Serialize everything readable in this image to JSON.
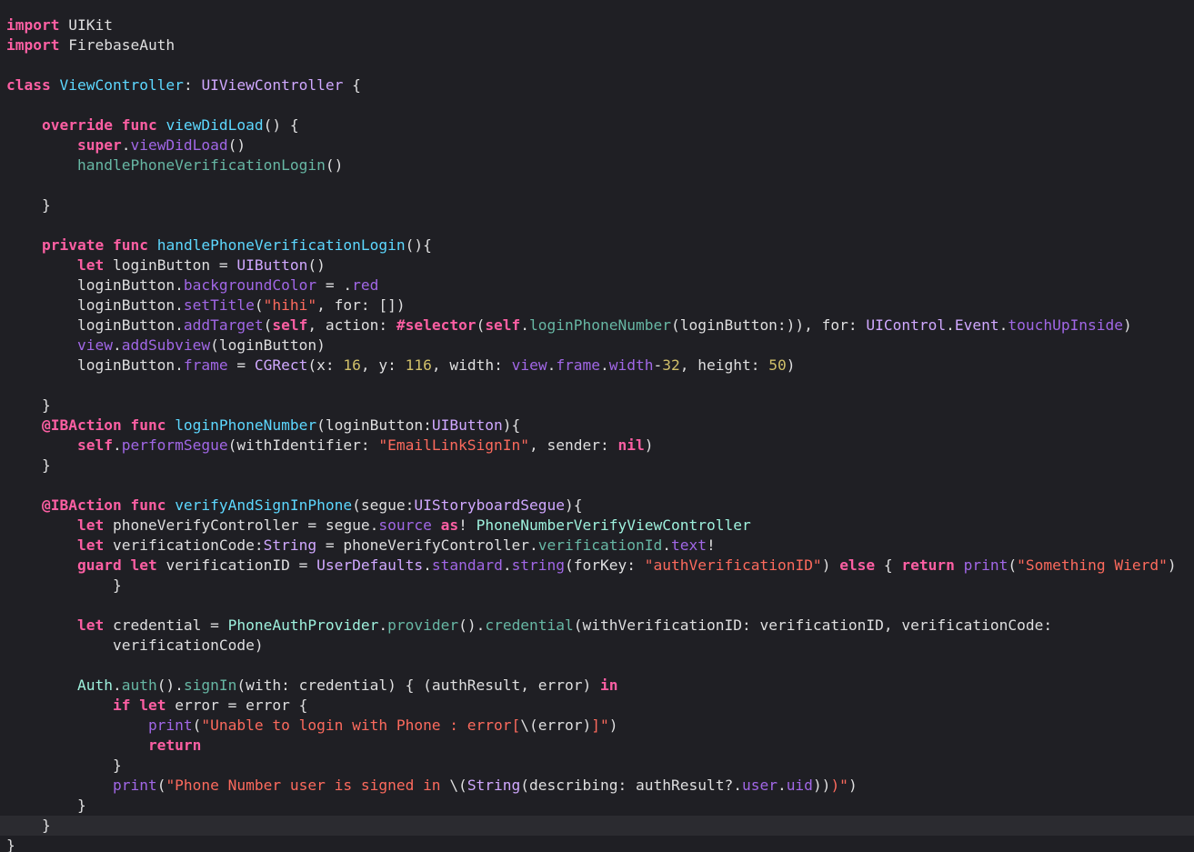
{
  "editor": {
    "language": "Swift",
    "theme": "dark",
    "colors": {
      "background": "#1f1f24",
      "current_line": "#2b2b30",
      "keyword": "#fc5fa3",
      "string": "#fc6a5d",
      "number": "#d0bf69",
      "type": "#d0a8ff",
      "declaration": "#5dd8ff",
      "project": "#9ef1dd",
      "plain": "#dfdfe0"
    },
    "current_line_index": 40,
    "lines": [
      [
        [
          "kw",
          "import"
        ],
        [
          "plain",
          " UIKit"
        ]
      ],
      [
        [
          "kw",
          "import"
        ],
        [
          "plain",
          " FirebaseAuth"
        ]
      ],
      [],
      [
        [
          "kw",
          "class"
        ],
        [
          "plain",
          " "
        ],
        [
          "decl",
          "ViewController"
        ],
        [
          "plain",
          ": "
        ],
        [
          "type",
          "UIViewController"
        ],
        [
          "plain",
          " {"
        ]
      ],
      [],
      [
        [
          "plain",
          "    "
        ],
        [
          "kw",
          "override"
        ],
        [
          "plain",
          " "
        ],
        [
          "kw",
          "func"
        ],
        [
          "plain",
          " "
        ],
        [
          "decl",
          "viewDidLoad"
        ],
        [
          "plain",
          "() {"
        ]
      ],
      [
        [
          "plain",
          "        "
        ],
        [
          "kw",
          "super"
        ],
        [
          "plain",
          "."
        ],
        [
          "func",
          "viewDidLoad"
        ],
        [
          "plain",
          "()"
        ]
      ],
      [
        [
          "plain",
          "        "
        ],
        [
          "projm",
          "handlePhoneVerificationLogin"
        ],
        [
          "plain",
          "()"
        ]
      ],
      [],
      [
        [
          "plain",
          "    }"
        ]
      ],
      [],
      [
        [
          "plain",
          "    "
        ],
        [
          "kw",
          "private"
        ],
        [
          "plain",
          " "
        ],
        [
          "kw",
          "func"
        ],
        [
          "plain",
          " "
        ],
        [
          "decl",
          "handlePhoneVerificationLogin"
        ],
        [
          "plain",
          "(){"
        ]
      ],
      [
        [
          "plain",
          "        "
        ],
        [
          "kw",
          "let"
        ],
        [
          "plain",
          " loginButton = "
        ],
        [
          "type",
          "UIButton"
        ],
        [
          "plain",
          "()"
        ]
      ],
      [
        [
          "plain",
          "        loginButton."
        ],
        [
          "func",
          "backgroundColor"
        ],
        [
          "plain",
          " = ."
        ],
        [
          "func",
          "red"
        ]
      ],
      [
        [
          "plain",
          "        loginButton."
        ],
        [
          "func",
          "setTitle"
        ],
        [
          "plain",
          "("
        ],
        [
          "str",
          "\"hihi\""
        ],
        [
          "plain",
          ", for: [])"
        ]
      ],
      [
        [
          "plain",
          "        loginButton."
        ],
        [
          "func",
          "addTarget"
        ],
        [
          "plain",
          "("
        ],
        [
          "kw",
          "self"
        ],
        [
          "plain",
          ", action: "
        ],
        [
          "kw",
          "#selector"
        ],
        [
          "plain",
          "("
        ],
        [
          "kw",
          "self"
        ],
        [
          "plain",
          "."
        ],
        [
          "projm",
          "loginPhoneNumber"
        ],
        [
          "plain",
          "(loginButton:)), for: "
        ],
        [
          "type",
          "UIControl"
        ],
        [
          "plain",
          "."
        ],
        [
          "type",
          "Event"
        ],
        [
          "plain",
          "."
        ],
        [
          "func",
          "touchUpInside"
        ],
        [
          "plain",
          ")"
        ]
      ],
      [
        [
          "plain",
          "        "
        ],
        [
          "func",
          "view"
        ],
        [
          "plain",
          "."
        ],
        [
          "func",
          "addSubview"
        ],
        [
          "plain",
          "(loginButton)"
        ]
      ],
      [
        [
          "plain",
          "        loginButton."
        ],
        [
          "func",
          "frame"
        ],
        [
          "plain",
          " = "
        ],
        [
          "type",
          "CGRect"
        ],
        [
          "plain",
          "(x: "
        ],
        [
          "num",
          "16"
        ],
        [
          "plain",
          ", y: "
        ],
        [
          "num",
          "116"
        ],
        [
          "plain",
          ", width: "
        ],
        [
          "func",
          "view"
        ],
        [
          "plain",
          "."
        ],
        [
          "func",
          "frame"
        ],
        [
          "plain",
          "."
        ],
        [
          "func",
          "width"
        ],
        [
          "plain",
          "-"
        ],
        [
          "num",
          "32"
        ],
        [
          "plain",
          ", height: "
        ],
        [
          "num",
          "50"
        ],
        [
          "plain",
          ")"
        ]
      ],
      [],
      [
        [
          "plain",
          "    }"
        ]
      ],
      [
        [
          "plain",
          "    "
        ],
        [
          "kw",
          "@IBAction"
        ],
        [
          "plain",
          " "
        ],
        [
          "kw",
          "func"
        ],
        [
          "plain",
          " "
        ],
        [
          "decl",
          "loginPhoneNumber"
        ],
        [
          "plain",
          "(loginButton:"
        ],
        [
          "type",
          "UIButton"
        ],
        [
          "plain",
          "){"
        ]
      ],
      [
        [
          "plain",
          "        "
        ],
        [
          "kw",
          "self"
        ],
        [
          "plain",
          "."
        ],
        [
          "func",
          "performSegue"
        ],
        [
          "plain",
          "(withIdentifier: "
        ],
        [
          "str",
          "\"EmailLinkSignIn\""
        ],
        [
          "plain",
          ", sender: "
        ],
        [
          "kw",
          "nil"
        ],
        [
          "plain",
          ")"
        ]
      ],
      [
        [
          "plain",
          "    }"
        ]
      ],
      [],
      [
        [
          "plain",
          "    "
        ],
        [
          "kw",
          "@IBAction"
        ],
        [
          "plain",
          " "
        ],
        [
          "kw",
          "func"
        ],
        [
          "plain",
          " "
        ],
        [
          "decl",
          "verifyAndSignInPhone"
        ],
        [
          "plain",
          "(segue:"
        ],
        [
          "type",
          "UIStoryboardSegue"
        ],
        [
          "plain",
          "){"
        ]
      ],
      [
        [
          "plain",
          "        "
        ],
        [
          "kw",
          "let"
        ],
        [
          "plain",
          " phoneVerifyController = segue."
        ],
        [
          "func",
          "source"
        ],
        [
          "plain",
          " "
        ],
        [
          "kw",
          "as"
        ],
        [
          "plain",
          "! "
        ],
        [
          "proj",
          "PhoneNumberVerifyViewController"
        ]
      ],
      [
        [
          "plain",
          "        "
        ],
        [
          "kw",
          "let"
        ],
        [
          "plain",
          " verificationCode:"
        ],
        [
          "type",
          "String"
        ],
        [
          "plain",
          " = phoneVerifyController."
        ],
        [
          "projm",
          "verificationId"
        ],
        [
          "plain",
          "."
        ],
        [
          "func",
          "text"
        ],
        [
          "plain",
          "!"
        ]
      ],
      [
        [
          "plain",
          "        "
        ],
        [
          "kw",
          "guard"
        ],
        [
          "plain",
          " "
        ],
        [
          "kw",
          "let"
        ],
        [
          "plain",
          " verificationID = "
        ],
        [
          "type",
          "UserDefaults"
        ],
        [
          "plain",
          "."
        ],
        [
          "func",
          "standard"
        ],
        [
          "plain",
          "."
        ],
        [
          "func",
          "string"
        ],
        [
          "plain",
          "(forKey: "
        ],
        [
          "str",
          "\"authVerificationID\""
        ],
        [
          "plain",
          ") "
        ],
        [
          "kw",
          "else"
        ],
        [
          "plain",
          " { "
        ],
        [
          "kw",
          "return"
        ],
        [
          "plain",
          " "
        ],
        [
          "func",
          "print"
        ],
        [
          "plain",
          "("
        ],
        [
          "str",
          "\"Something Wierd\""
        ],
        [
          "plain",
          ")"
        ]
      ],
      [
        [
          "plain",
          "            }"
        ]
      ],
      [],
      [
        [
          "plain",
          "        "
        ],
        [
          "kw",
          "let"
        ],
        [
          "plain",
          " credential = "
        ],
        [
          "proj",
          "PhoneAuthProvider"
        ],
        [
          "plain",
          "."
        ],
        [
          "projm",
          "provider"
        ],
        [
          "plain",
          "()."
        ],
        [
          "projm",
          "credential"
        ],
        [
          "plain",
          "(withVerificationID: verificationID, verificationCode:"
        ]
      ],
      [
        [
          "plain",
          "            verificationCode)"
        ]
      ],
      [],
      [
        [
          "plain",
          "        "
        ],
        [
          "proj",
          "Auth"
        ],
        [
          "plain",
          "."
        ],
        [
          "projm",
          "auth"
        ],
        [
          "plain",
          "()."
        ],
        [
          "projm",
          "signIn"
        ],
        [
          "plain",
          "(with: credential) { (authResult, error) "
        ],
        [
          "kw",
          "in"
        ]
      ],
      [
        [
          "plain",
          "            "
        ],
        [
          "kw",
          "if"
        ],
        [
          "plain",
          " "
        ],
        [
          "kw",
          "let"
        ],
        [
          "plain",
          " error = error {"
        ]
      ],
      [
        [
          "plain",
          "                "
        ],
        [
          "func",
          "print"
        ],
        [
          "plain",
          "("
        ],
        [
          "str",
          "\"Unable to login with Phone : error["
        ],
        [
          "plain",
          "\\(error)"
        ],
        [
          "str",
          "]\""
        ],
        [
          "plain",
          ")"
        ]
      ],
      [
        [
          "plain",
          "                "
        ],
        [
          "kw",
          "return"
        ]
      ],
      [
        [
          "plain",
          "            }"
        ]
      ],
      [
        [
          "plain",
          "            "
        ],
        [
          "func",
          "print"
        ],
        [
          "plain",
          "("
        ],
        [
          "str",
          "\"Phone Number user is signed in "
        ],
        [
          "plain",
          "\\("
        ],
        [
          "type",
          "String"
        ],
        [
          "plain",
          "(describing: authResult?."
        ],
        [
          "func",
          "user"
        ],
        [
          "plain",
          "."
        ],
        [
          "func",
          "uid"
        ],
        [
          "plain",
          "))"
        ],
        [
          "str",
          ")\""
        ],
        [
          "plain",
          ")"
        ]
      ],
      [
        [
          "plain",
          "        }"
        ]
      ],
      [
        [
          "plain",
          "    }"
        ]
      ],
      [
        [
          "plain",
          "}"
        ]
      ]
    ]
  }
}
